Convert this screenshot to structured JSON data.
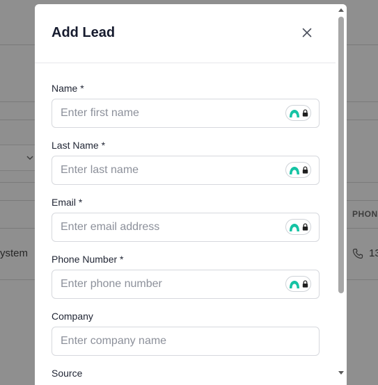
{
  "background": {
    "row_text": "ystem",
    "column_header": "PHON",
    "phone_value": "13"
  },
  "modal": {
    "title": "Add Lead",
    "fields": [
      {
        "label": "Name *",
        "placeholder": "Enter first name",
        "value": "",
        "password_manager_badge": true
      },
      {
        "label": "Last Name *",
        "placeholder": "Enter last name",
        "value": "",
        "password_manager_badge": true
      },
      {
        "label": "Email *",
        "placeholder": "Enter email address",
        "value": "",
        "password_manager_badge": true
      },
      {
        "label": "Phone Number *",
        "placeholder": "Enter phone number",
        "value": "",
        "password_manager_badge": true
      },
      {
        "label": "Company",
        "placeholder": "Enter company name",
        "value": "",
        "password_manager_badge": false
      },
      {
        "label": "Source",
        "placeholder": "",
        "value": "",
        "password_manager_badge": false
      }
    ]
  },
  "colors": {
    "overlay": "#8f8f8f",
    "title": "#161b2e",
    "badge_accent": "#15c3a4",
    "input_border": "#d6d8dd",
    "placeholder": "#8c909a"
  },
  "icons": {
    "close": "close-icon",
    "badge": "password-manager-icon",
    "lock": "lock-icon",
    "phone": "phone-icon",
    "chevron": "chevron-down-icon"
  }
}
